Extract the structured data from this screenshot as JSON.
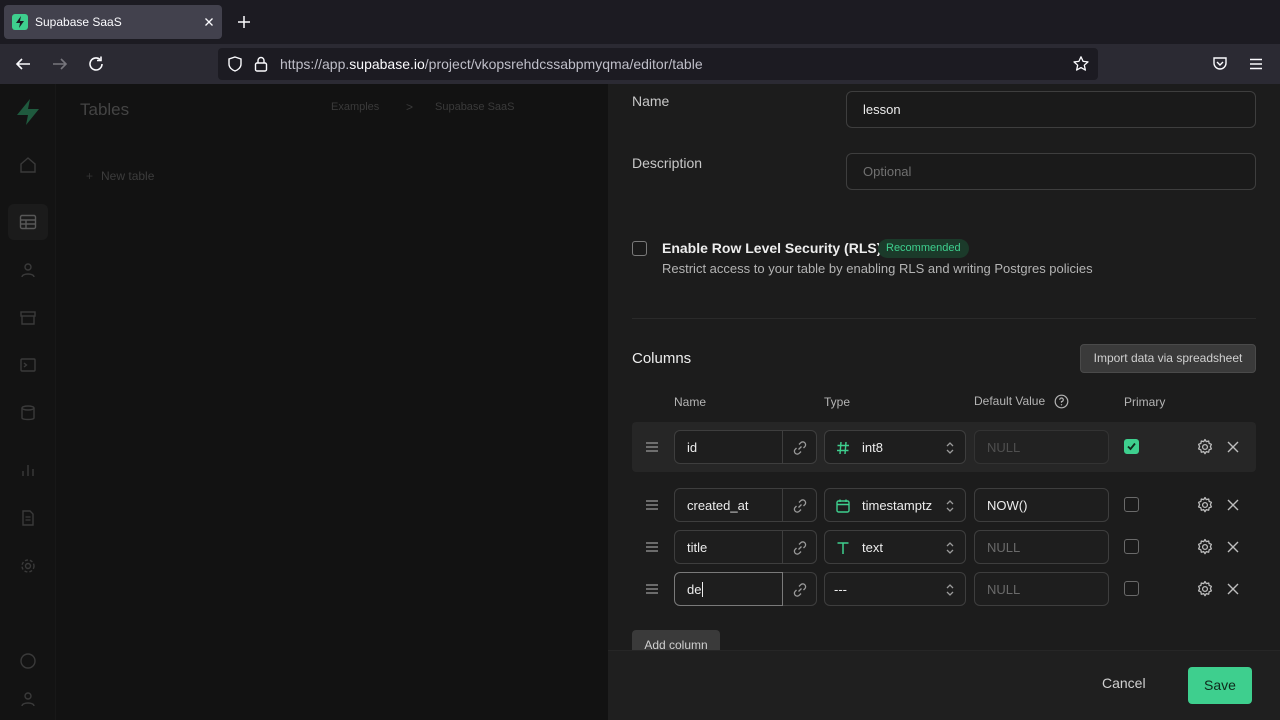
{
  "browser": {
    "tab_title": "Supabase SaaS",
    "url_prefix": "https://app.",
    "url_host": "supabase.io",
    "url_path": "/project/vkopsrehdcssabpmyqma/editor/table"
  },
  "app": {
    "page_title": "Tables",
    "breadcrumb": [
      "Examples",
      "Supabase SaaS"
    ],
    "breadcrumb_separator": ">",
    "new_table_label": "New table"
  },
  "panel": {
    "name_label": "Name",
    "name_value": "lesson",
    "description_label": "Description",
    "description_placeholder": "Optional",
    "rls": {
      "title": "Enable Row Level Security (RLS)",
      "badge": "Recommended",
      "description": "Restrict access to your table by enabling RLS and writing Postgres policies",
      "checked": false
    },
    "columns_title": "Columns",
    "import_label": "Import data via spreadsheet",
    "headers": {
      "name": "Name",
      "type": "Type",
      "default": "Default Value",
      "primary": "Primary"
    },
    "rows": [
      {
        "name": "id",
        "type": "int8",
        "type_icon": "hash-icon",
        "default": "NULL",
        "default_is_placeholder": true,
        "default_disabled": true,
        "primary": true
      },
      {
        "name": "created_at",
        "type": "timestamptz",
        "type_icon": "calendar-icon",
        "default": "NOW()",
        "default_is_placeholder": false,
        "default_disabled": false,
        "primary": false
      },
      {
        "name": "title",
        "type": "text",
        "type_icon": "text-type-icon",
        "default": "NULL",
        "default_is_placeholder": true,
        "default_disabled": false,
        "primary": false
      },
      {
        "name": "de",
        "type": "---",
        "type_icon": "",
        "default": "NULL",
        "default_is_placeholder": true,
        "default_disabled": false,
        "primary": false
      }
    ],
    "add_column_label": "Add column",
    "cancel_label": "Cancel",
    "save_label": "Save"
  },
  "colors": {
    "accent": "#3ecf8e",
    "panel_bg": "#1c1c1c",
    "overlay_bg": "#121212"
  }
}
